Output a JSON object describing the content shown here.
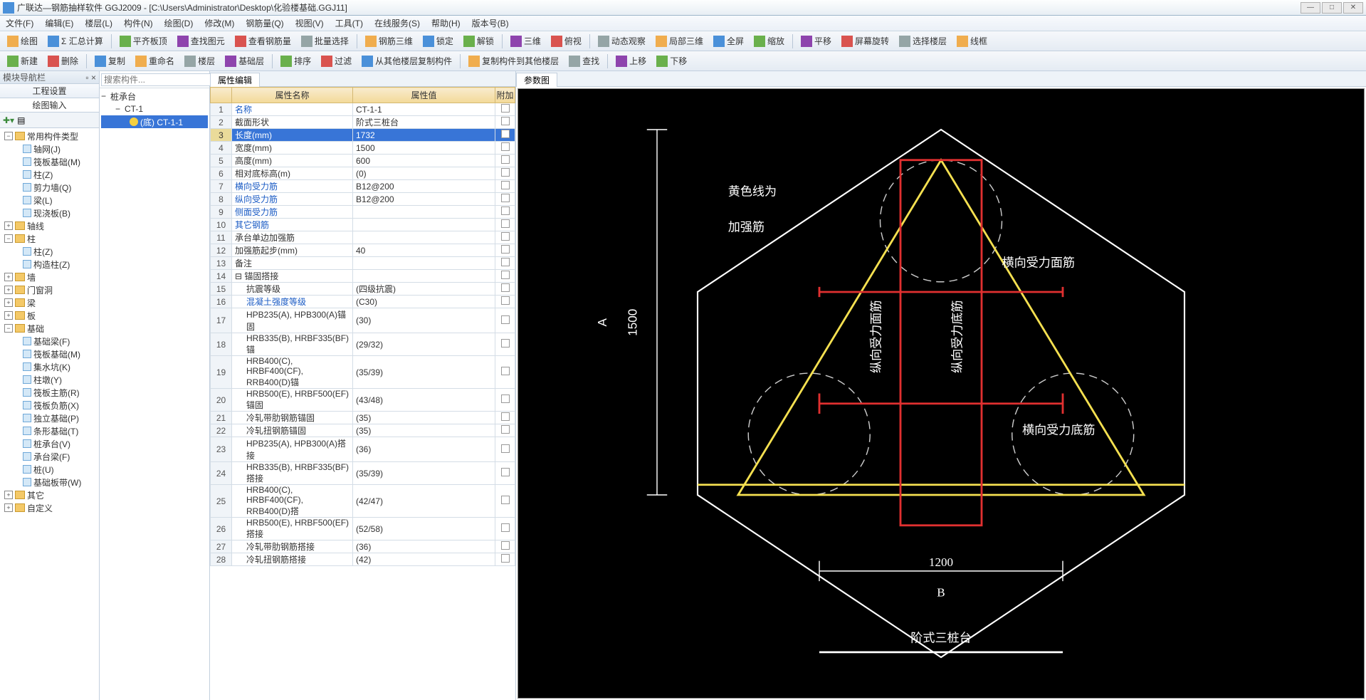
{
  "title": "广联达—钢筋抽样软件 GGJ2009 - [C:\\Users\\Administrator\\Desktop\\化验楼基础.GGJ11]",
  "menu": [
    "文件(F)",
    "编辑(E)",
    "楼层(L)",
    "构件(N)",
    "绘图(D)",
    "修改(M)",
    "钢筋量(Q)",
    "视图(V)",
    "工具(T)",
    "在线服务(S)",
    "帮助(H)",
    "版本号(B)"
  ],
  "toolbar1": [
    "绘图",
    "Σ 汇总计算",
    "平齐板顶",
    "查找图元",
    "查看钢筋量",
    "批量选择",
    "钢筋三维",
    "锁定",
    "解锁",
    "三维",
    "俯视",
    "动态观察",
    "局部三维",
    "全屏",
    "缩放",
    "平移",
    "屏幕旋转",
    "选择楼层",
    "线框"
  ],
  "toolbar2": [
    "新建",
    "删除",
    "复制",
    "重命名",
    "楼层",
    "基础层",
    "排序",
    "过滤",
    "从其他楼层复制构件",
    "复制构件到其他楼层",
    "查找",
    "上移",
    "下移"
  ],
  "nav": {
    "title": "模块导航栏",
    "tabs": [
      "工程设置",
      "绘图输入"
    ],
    "tree": [
      {
        "label": "常用构件类型",
        "type": "folder",
        "open": true,
        "children": [
          {
            "label": "轴网(J)",
            "icon": "grid"
          },
          {
            "label": "筏板基础(M)",
            "icon": "slab"
          },
          {
            "label": "柱(Z)",
            "icon": "col"
          },
          {
            "label": "剪力墙(Q)",
            "icon": "wall"
          },
          {
            "label": "梁(L)",
            "icon": "beam"
          },
          {
            "label": "现浇板(B)",
            "icon": "plate"
          }
        ]
      },
      {
        "label": "轴线",
        "type": "folder"
      },
      {
        "label": "柱",
        "type": "folder",
        "open": true,
        "children": [
          {
            "label": "柱(Z)",
            "icon": "col"
          },
          {
            "label": "构造柱(Z)",
            "icon": "col2"
          }
        ]
      },
      {
        "label": "墙",
        "type": "folder"
      },
      {
        "label": "门窗洞",
        "type": "folder"
      },
      {
        "label": "梁",
        "type": "folder"
      },
      {
        "label": "板",
        "type": "folder"
      },
      {
        "label": "基础",
        "type": "folder",
        "open": true,
        "children": [
          {
            "label": "基础梁(F)",
            "icon": "beam"
          },
          {
            "label": "筏板基础(M)",
            "icon": "slab"
          },
          {
            "label": "集水坑(K)",
            "icon": "pit"
          },
          {
            "label": "柱墩(Y)",
            "icon": "pier"
          },
          {
            "label": "筏板主筋(R)",
            "icon": "rebar"
          },
          {
            "label": "筏板负筋(X)",
            "icon": "rebar"
          },
          {
            "label": "独立基础(P)",
            "icon": "found"
          },
          {
            "label": "条形基础(T)",
            "icon": "strip"
          },
          {
            "label": "桩承台(V)",
            "icon": "cap"
          },
          {
            "label": "承台梁(F)",
            "icon": "beam"
          },
          {
            "label": "桩(U)",
            "icon": "pile"
          },
          {
            "label": "基础板带(W)",
            "icon": "band"
          }
        ]
      },
      {
        "label": "其它",
        "type": "folder"
      },
      {
        "label": "自定义",
        "type": "folder"
      }
    ]
  },
  "search": {
    "placeholder": "搜索构件..."
  },
  "midtree": [
    {
      "label": "桩承台",
      "lvl": 0
    },
    {
      "label": "CT-1",
      "lvl": 1
    },
    {
      "label": "(底) CT-1-1",
      "lvl": 2,
      "sel": true
    }
  ],
  "prop": {
    "tab": "属性编辑",
    "headers": [
      "",
      "属性名称",
      "属性值",
      "附加"
    ],
    "rows": [
      {
        "n": "1",
        "name": "名称",
        "value": "CT-1-1",
        "blue": true
      },
      {
        "n": "2",
        "name": "截面形状",
        "value": "阶式三桩台"
      },
      {
        "n": "3",
        "name": "长度(mm)",
        "value": "1732",
        "blue": true,
        "sel": true
      },
      {
        "n": "4",
        "name": "宽度(mm)",
        "value": "1500",
        "gray": true
      },
      {
        "n": "5",
        "name": "高度(mm)",
        "value": "600",
        "gray": true
      },
      {
        "n": "6",
        "name": "相对底标高(m)",
        "value": "(0)"
      },
      {
        "n": "7",
        "name": "横向受力筋",
        "value": "B12@200",
        "blue": true
      },
      {
        "n": "8",
        "name": "纵向受力筋",
        "value": "B12@200",
        "blue": true
      },
      {
        "n": "9",
        "name": "侧面受力筋",
        "value": "",
        "blue": true
      },
      {
        "n": "10",
        "name": "其它钢筋",
        "value": "",
        "blue": true
      },
      {
        "n": "11",
        "name": "承台单边加强筋",
        "value": ""
      },
      {
        "n": "12",
        "name": "加强筋起步(mm)",
        "value": "40"
      },
      {
        "n": "13",
        "name": "备注",
        "value": ""
      },
      {
        "n": "14",
        "name": "锚固搭接",
        "value": "",
        "group": true,
        "gray": true
      },
      {
        "n": "15",
        "name": "抗震等级",
        "value": "(四级抗震)",
        "indent": true
      },
      {
        "n": "16",
        "name": "混凝土强度等级",
        "value": "(C30)",
        "indent": true,
        "blue": true
      },
      {
        "n": "17",
        "name": "HPB235(A), HPB300(A)锚固",
        "value": "(30)",
        "indent": true
      },
      {
        "n": "18",
        "name": "HRB335(B), HRBF335(BF)锚",
        "value": "(29/32)",
        "indent": true
      },
      {
        "n": "19",
        "name": "HRB400(C), HRBF400(CF), RRB400(D)锚",
        "value": "(35/39)",
        "indent": true
      },
      {
        "n": "20",
        "name": "HRB500(E), HRBF500(EF)锚固",
        "value": "(43/48)",
        "indent": true
      },
      {
        "n": "21",
        "name": "冷轧带肋钢筋锚固",
        "value": "(35)",
        "indent": true
      },
      {
        "n": "22",
        "name": "冷轧扭钢筋锚固",
        "value": "(35)",
        "indent": true
      },
      {
        "n": "23",
        "name": "HPB235(A), HPB300(A)搭接",
        "value": "(36)",
        "indent": true
      },
      {
        "n": "24",
        "name": "HRB335(B), HRBF335(BF)搭接",
        "value": "(35/39)",
        "indent": true
      },
      {
        "n": "25",
        "name": "HRB400(C), HRBF400(CF), RRB400(D)搭",
        "value": "(42/47)",
        "indent": true
      },
      {
        "n": "26",
        "name": "HRB500(E), HRBF500(EF)搭接",
        "value": "(52/58)",
        "indent": true
      },
      {
        "n": "27",
        "name": "冷轧带肋钢筋搭接",
        "value": "(36)",
        "indent": true
      },
      {
        "n": "28",
        "name": "冷轧扭钢筋搭接",
        "value": "(42)",
        "indent": true
      }
    ]
  },
  "preview": {
    "tab": "参数图",
    "labels": {
      "yellow1": "黄色线为",
      "yellow2": "加强筋",
      "htop": "横向受力面筋",
      "hbot": "横向受力底筋",
      "vtop": "纵向受力面筋",
      "vbot": "纵向受力底筋",
      "dimA": "A",
      "valA": "1500",
      "dimB": "B",
      "valB": "1200",
      "title": "阶式三桩台"
    }
  }
}
